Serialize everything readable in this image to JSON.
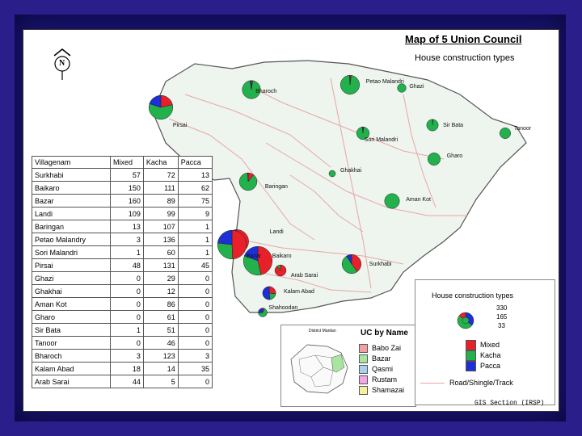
{
  "map": {
    "title": "Map of 5 Union Council",
    "subtitle": "House construction types",
    "north_label": "N",
    "credit": "GIS Section (IRSP)"
  },
  "colors": {
    "mixed": "#e8202a",
    "kacha": "#22b14c",
    "pacca": "#1d2fd6",
    "land": "#eef4ee",
    "road": "#e9a6a6",
    "boundary": "#555555"
  },
  "table": {
    "headers": [
      "Villagenam",
      "Mixed",
      "Kacha",
      "Pacca"
    ],
    "rows": [
      {
        "name": "Surkhabi",
        "mixed": "57",
        "kacha": "72",
        "pacca": "13"
      },
      {
        "name": "Baikaro",
        "mixed": "150",
        "kacha": "111",
        "pacca": "62"
      },
      {
        "name": "Bazar",
        "mixed": "160",
        "kacha": "89",
        "pacca": "75"
      },
      {
        "name": "Landi",
        "mixed": "109",
        "kacha": "99",
        "pacca": "9"
      },
      {
        "name": "Baringan",
        "mixed": "13",
        "kacha": "107",
        "pacca": "1"
      },
      {
        "name": "Petao Malandry",
        "mixed": "3",
        "kacha": "136",
        "pacca": "1"
      },
      {
        "name": "Sori Malandri",
        "mixed": "1",
        "kacha": "60",
        "pacca": "1"
      },
      {
        "name": "Pirsai",
        "mixed": "48",
        "kacha": "131",
        "pacca": "45"
      },
      {
        "name": "Ghazi",
        "mixed": "0",
        "kacha": "29",
        "pacca": "0"
      },
      {
        "name": "Ghakhai",
        "mixed": "0",
        "kacha": "12",
        "pacca": "0"
      },
      {
        "name": "Aman Kot",
        "mixed": "0",
        "kacha": "86",
        "pacca": "0"
      },
      {
        "name": "Gharo",
        "mixed": "0",
        "kacha": "61",
        "pacca": "0"
      },
      {
        "name": "Sir Bata",
        "mixed": "1",
        "kacha": "51",
        "pacca": "0"
      },
      {
        "name": "Tanoor",
        "mixed": "0",
        "kacha": "46",
        "pacca": "0"
      },
      {
        "name": "Bharoch",
        "mixed": "3",
        "kacha": "123",
        "pacca": "3"
      },
      {
        "name": "Kalam Abad",
        "mixed": "18",
        "kacha": "14",
        "pacca": "35"
      },
      {
        "name": "Arab Sarai",
        "mixed": "44",
        "kacha": "5",
        "pacca": "0"
      }
    ]
  },
  "places": [
    {
      "label": "Bharoch",
      "mixed": 3,
      "kacha": 123,
      "pacca": 3
    },
    {
      "label": "Petao Malandri",
      "mixed": 3,
      "kacha": 136,
      "pacca": 1
    },
    {
      "label": "Ghazi",
      "mixed": 0,
      "kacha": 29,
      "pacca": 0
    },
    {
      "label": "Pirsai",
      "mixed": 48,
      "kacha": 131,
      "pacca": 45
    },
    {
      "label": "Sir Bata",
      "mixed": 1,
      "kacha": 51,
      "pacca": 0
    },
    {
      "label": "Tanoor",
      "mixed": 0,
      "kacha": 46,
      "pacca": 0
    },
    {
      "label": "Sori Malandri",
      "mixed": 1,
      "kacha": 60,
      "pacca": 1
    },
    {
      "label": "Gharo",
      "mixed": 0,
      "kacha": 61,
      "pacca": 0
    },
    {
      "label": "Ghakhai",
      "mixed": 0,
      "kacha": 12,
      "pacca": 0
    },
    {
      "label": "Baringan",
      "mixed": 13,
      "kacha": 107,
      "pacca": 1
    },
    {
      "label": "Aman Kot",
      "mixed": 0,
      "kacha": 86,
      "pacca": 0
    },
    {
      "label": "Landi",
      "mixed": 109,
      "kacha": 99,
      "pacca": 9
    },
    {
      "label": "Bazar",
      "mixed": 160,
      "kacha": 89,
      "pacca": 75
    },
    {
      "label": "Baikaro",
      "mixed": 150,
      "kacha": 111,
      "pacca": 62
    },
    {
      "label": "Surkhabi",
      "mixed": 57,
      "kacha": 72,
      "pacca": 13
    },
    {
      "label": "Arab Sarai",
      "mixed": 44,
      "kacha": 5,
      "pacca": 0
    },
    {
      "label": "Kalam Abad",
      "mixed": 18,
      "kacha": 14,
      "pacca": 35
    },
    {
      "label": "Shahoodan",
      "mixed": 2,
      "kacha": 20,
      "pacca": 8
    }
  ],
  "legend": {
    "title": "House construction types",
    "sizes": [
      "330",
      "165",
      "33"
    ],
    "items": [
      "Mixed",
      "Kacha",
      "Pacca"
    ],
    "road": "Road/Shingle/Track"
  },
  "uc": {
    "inset_label": "District Mardan",
    "title": "UC by Name",
    "items": [
      {
        "name": "Babo Zai",
        "color": "#f2a0a0"
      },
      {
        "name": "Bazar",
        "color": "#a8e6a0"
      },
      {
        "name": "Qasmi",
        "color": "#a8d0f0"
      },
      {
        "name": "Rustam",
        "color": "#f0a8e6"
      },
      {
        "name": "Shamazai",
        "color": "#f6f0a0"
      }
    ]
  }
}
